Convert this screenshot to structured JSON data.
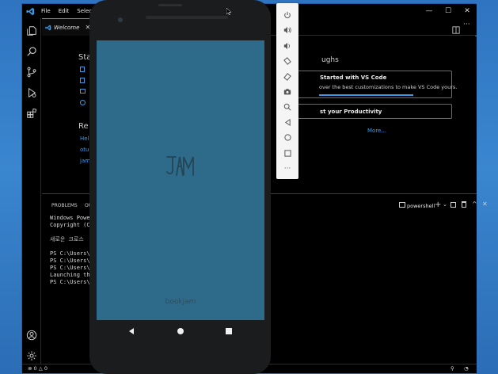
{
  "titlebar": {
    "menu": [
      "File",
      "Edit",
      "Selectio"
    ],
    "controls": [
      "—",
      "☐",
      "✕"
    ]
  },
  "tab": {
    "label": "Welcome",
    "close": "✕"
  },
  "welcome": {
    "start_heading": "Sta",
    "recent_heading": "Re",
    "recent_items": [
      "Hel",
      "otu",
      "jam"
    ],
    "walkthroughs_heading": "ughs",
    "card1_title": "Started with VS Code",
    "card1_desc": "over the best customizations to make VS Code yours.",
    "card2_title": "st your Productivity",
    "more_link": "More..."
  },
  "panel": {
    "tab_problems": "PROBLEMS",
    "tab_output": "OU",
    "terminal_name": "powershell",
    "lines": [
      "Windows Power",
      "Copyright (C)",
      "",
      "새로운 크로스",
      "",
      "PS C:\\Users\\C",
      "PS C:\\Users\\C",
      "PS C:\\Users\\C",
      "Launching the",
      "PS C:\\Users\\C"
    ]
  },
  "status": {
    "errors": "0",
    "warnings": "0"
  },
  "app": {
    "name": "bookjam"
  },
  "colors": {
    "app_background": "#2e6b8a",
    "accent": "#4a90e2"
  }
}
